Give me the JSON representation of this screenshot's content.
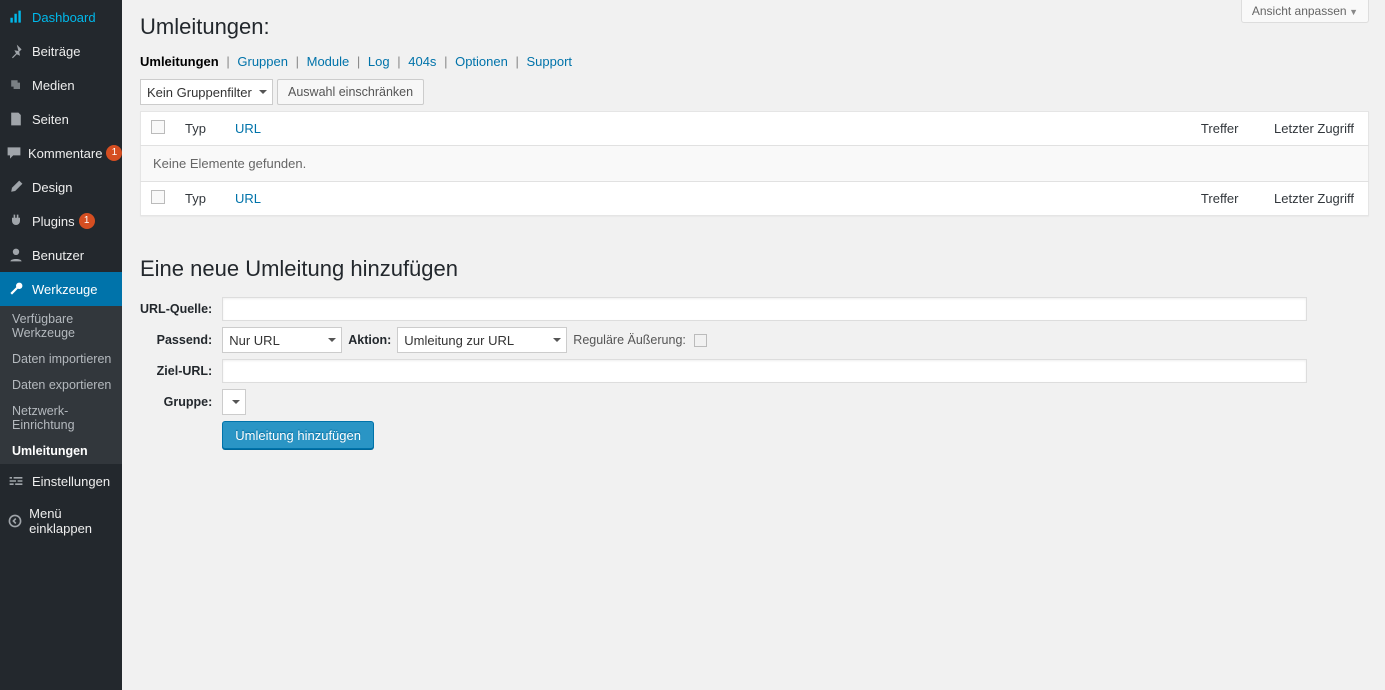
{
  "sidebar": {
    "items": [
      {
        "label": "Dashboard"
      },
      {
        "label": "Beiträge"
      },
      {
        "label": "Medien"
      },
      {
        "label": "Seiten"
      },
      {
        "label": "Kommentare",
        "badge": "1"
      },
      {
        "label": "Design"
      },
      {
        "label": "Plugins",
        "badge": "1"
      },
      {
        "label": "Benutzer"
      },
      {
        "label": "Werkzeuge"
      },
      {
        "label": "Einstellungen"
      },
      {
        "label": "Menü einklappen"
      }
    ],
    "submenu": [
      {
        "label": "Verfügbare Werkzeuge"
      },
      {
        "label": "Daten importieren"
      },
      {
        "label": "Daten exportieren"
      },
      {
        "label": "Netzwerk-Einrichtung"
      },
      {
        "label": "Umleitungen"
      }
    ]
  },
  "screen_options": "Ansicht anpassen",
  "page_title": "Umleitungen:",
  "subnav": [
    "Umleitungen",
    "Gruppen",
    "Module",
    "Log",
    "404s",
    "Optionen",
    "Support"
  ],
  "filter": {
    "group_select": "Kein Gruppenfilter",
    "restrict_btn": "Auswahl einschränken"
  },
  "table": {
    "headers": {
      "typ": "Typ",
      "url": "URL",
      "treffer": "Treffer",
      "letzter": "Letzter Zugriff"
    },
    "no_items": "Keine Elemente gefunden."
  },
  "add_section": {
    "title": "Eine neue Umleitung hinzufügen",
    "url_source_label": "URL-Quelle:",
    "passend_label": "Passend:",
    "passend_value": "Nur URL",
    "aktion_label": "Aktion:",
    "aktion_value": "Umleitung zur URL",
    "regex_label": "Reguläre Äußerung:",
    "ziel_label": "Ziel-URL:",
    "gruppe_label": "Gruppe:",
    "submit": "Umleitung hinzufügen"
  }
}
